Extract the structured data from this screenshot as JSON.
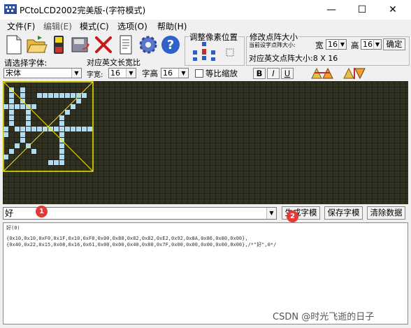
{
  "window": {
    "title": "PCtoLCD2002完美版-(字符模式)",
    "minimize": "—",
    "maximize": "☐",
    "close": "✕"
  },
  "menu": [
    {
      "label": "文件(F)"
    },
    {
      "label": "编辑(E)"
    },
    {
      "label": "模式(C)"
    },
    {
      "label": "选项(O)"
    },
    {
      "label": "帮助(H)"
    }
  ],
  "toolbar_icons": [
    "new-file-icon",
    "open-folder-icon",
    "save-icon",
    "save-as-icon",
    "delete-icon",
    "notepad-icon",
    "settings-gear-icon",
    "help-icon"
  ],
  "font_panel": {
    "select_font_label": "请选择字体:",
    "font_value": "宋体",
    "english_width_label": "对应英文长宽比",
    "width_label": "字宽:",
    "width_value": "16",
    "height_label": "字高",
    "height_value": "16",
    "proportional_label": "等比缩放",
    "bold": "B",
    "italic": "I",
    "underline": "U"
  },
  "adjust_panel": {
    "title": "调整像素位置"
  },
  "dot_panel": {
    "title": "修改点阵大小",
    "current_label": "当前设字点阵大小:",
    "width_label": "宽",
    "width_value": "16",
    "height_label": "高",
    "height_value": "16",
    "confirm": "确定",
    "english_size_label": "对应英文点阵大小:8 X 16"
  },
  "input": {
    "value": "好"
  },
  "buttons": {
    "generate": "生成字模",
    "save": "保存字模",
    "clear": "清除数据"
  },
  "output": {
    "line1": "好(0)",
    "line2": "{0x10,0x10,0xF0,0x1F,0x10,0xF0,0x00,0x80,0x82,0x82,0xE2,0x92,0x8A,0x86,0x80,0x00},",
    "line3": "{0x40,0x22,0x15,0x08,0x16,0x61,0x00,0x00,0x40,0x80,0x7F,0x00,0x00,0x00,0x00,0x00},/*\"好\",0*/"
  },
  "badges": {
    "one": "1",
    "two": "2"
  },
  "watermark": "CSDN @时光飞逝的日子",
  "glyph_pixels": [
    [
      1,
      1
    ],
    [
      3,
      1
    ],
    [
      1,
      2
    ],
    [
      3,
      2
    ],
    [
      6,
      2
    ],
    [
      7,
      2
    ],
    [
      8,
      2
    ],
    [
      9,
      2
    ],
    [
      10,
      2
    ],
    [
      11,
      2
    ],
    [
      12,
      2
    ],
    [
      13,
      2
    ],
    [
      14,
      2
    ],
    [
      1,
      3
    ],
    [
      3,
      3
    ],
    [
      13,
      3
    ],
    [
      0,
      4
    ],
    [
      1,
      4
    ],
    [
      2,
      4
    ],
    [
      3,
      4
    ],
    [
      4,
      4
    ],
    [
      5,
      4
    ],
    [
      12,
      4
    ],
    [
      1,
      5
    ],
    [
      4,
      5
    ],
    [
      11,
      5
    ],
    [
      1,
      6
    ],
    [
      4,
      6
    ],
    [
      10,
      6
    ],
    [
      1,
      7
    ],
    [
      4,
      7
    ],
    [
      10,
      7
    ],
    [
      0,
      8
    ],
    [
      2,
      8
    ],
    [
      3,
      8
    ],
    [
      4,
      8
    ],
    [
      5,
      8
    ],
    [
      6,
      8
    ],
    [
      7,
      8
    ],
    [
      8,
      8
    ],
    [
      9,
      8
    ],
    [
      10,
      8
    ],
    [
      11,
      8
    ],
    [
      12,
      8
    ],
    [
      13,
      8
    ],
    [
      14,
      8
    ],
    [
      15,
      8
    ],
    [
      0,
      9
    ],
    [
      3,
      9
    ],
    [
      10,
      9
    ],
    [
      3,
      10
    ],
    [
      10,
      10
    ],
    [
      2,
      11
    ],
    [
      4,
      11
    ],
    [
      10,
      11
    ],
    [
      1,
      12
    ],
    [
      5,
      12
    ],
    [
      10,
      12
    ],
    [
      0,
      13
    ],
    [
      10,
      13
    ],
    [
      8,
      14
    ],
    [
      9,
      14
    ],
    [
      10,
      14
    ]
  ],
  "colors": {
    "grid_bg": "#303317",
    "pixel_on": "#a9dff7",
    "selection": "#f2e400",
    "badge": "#e53935"
  }
}
